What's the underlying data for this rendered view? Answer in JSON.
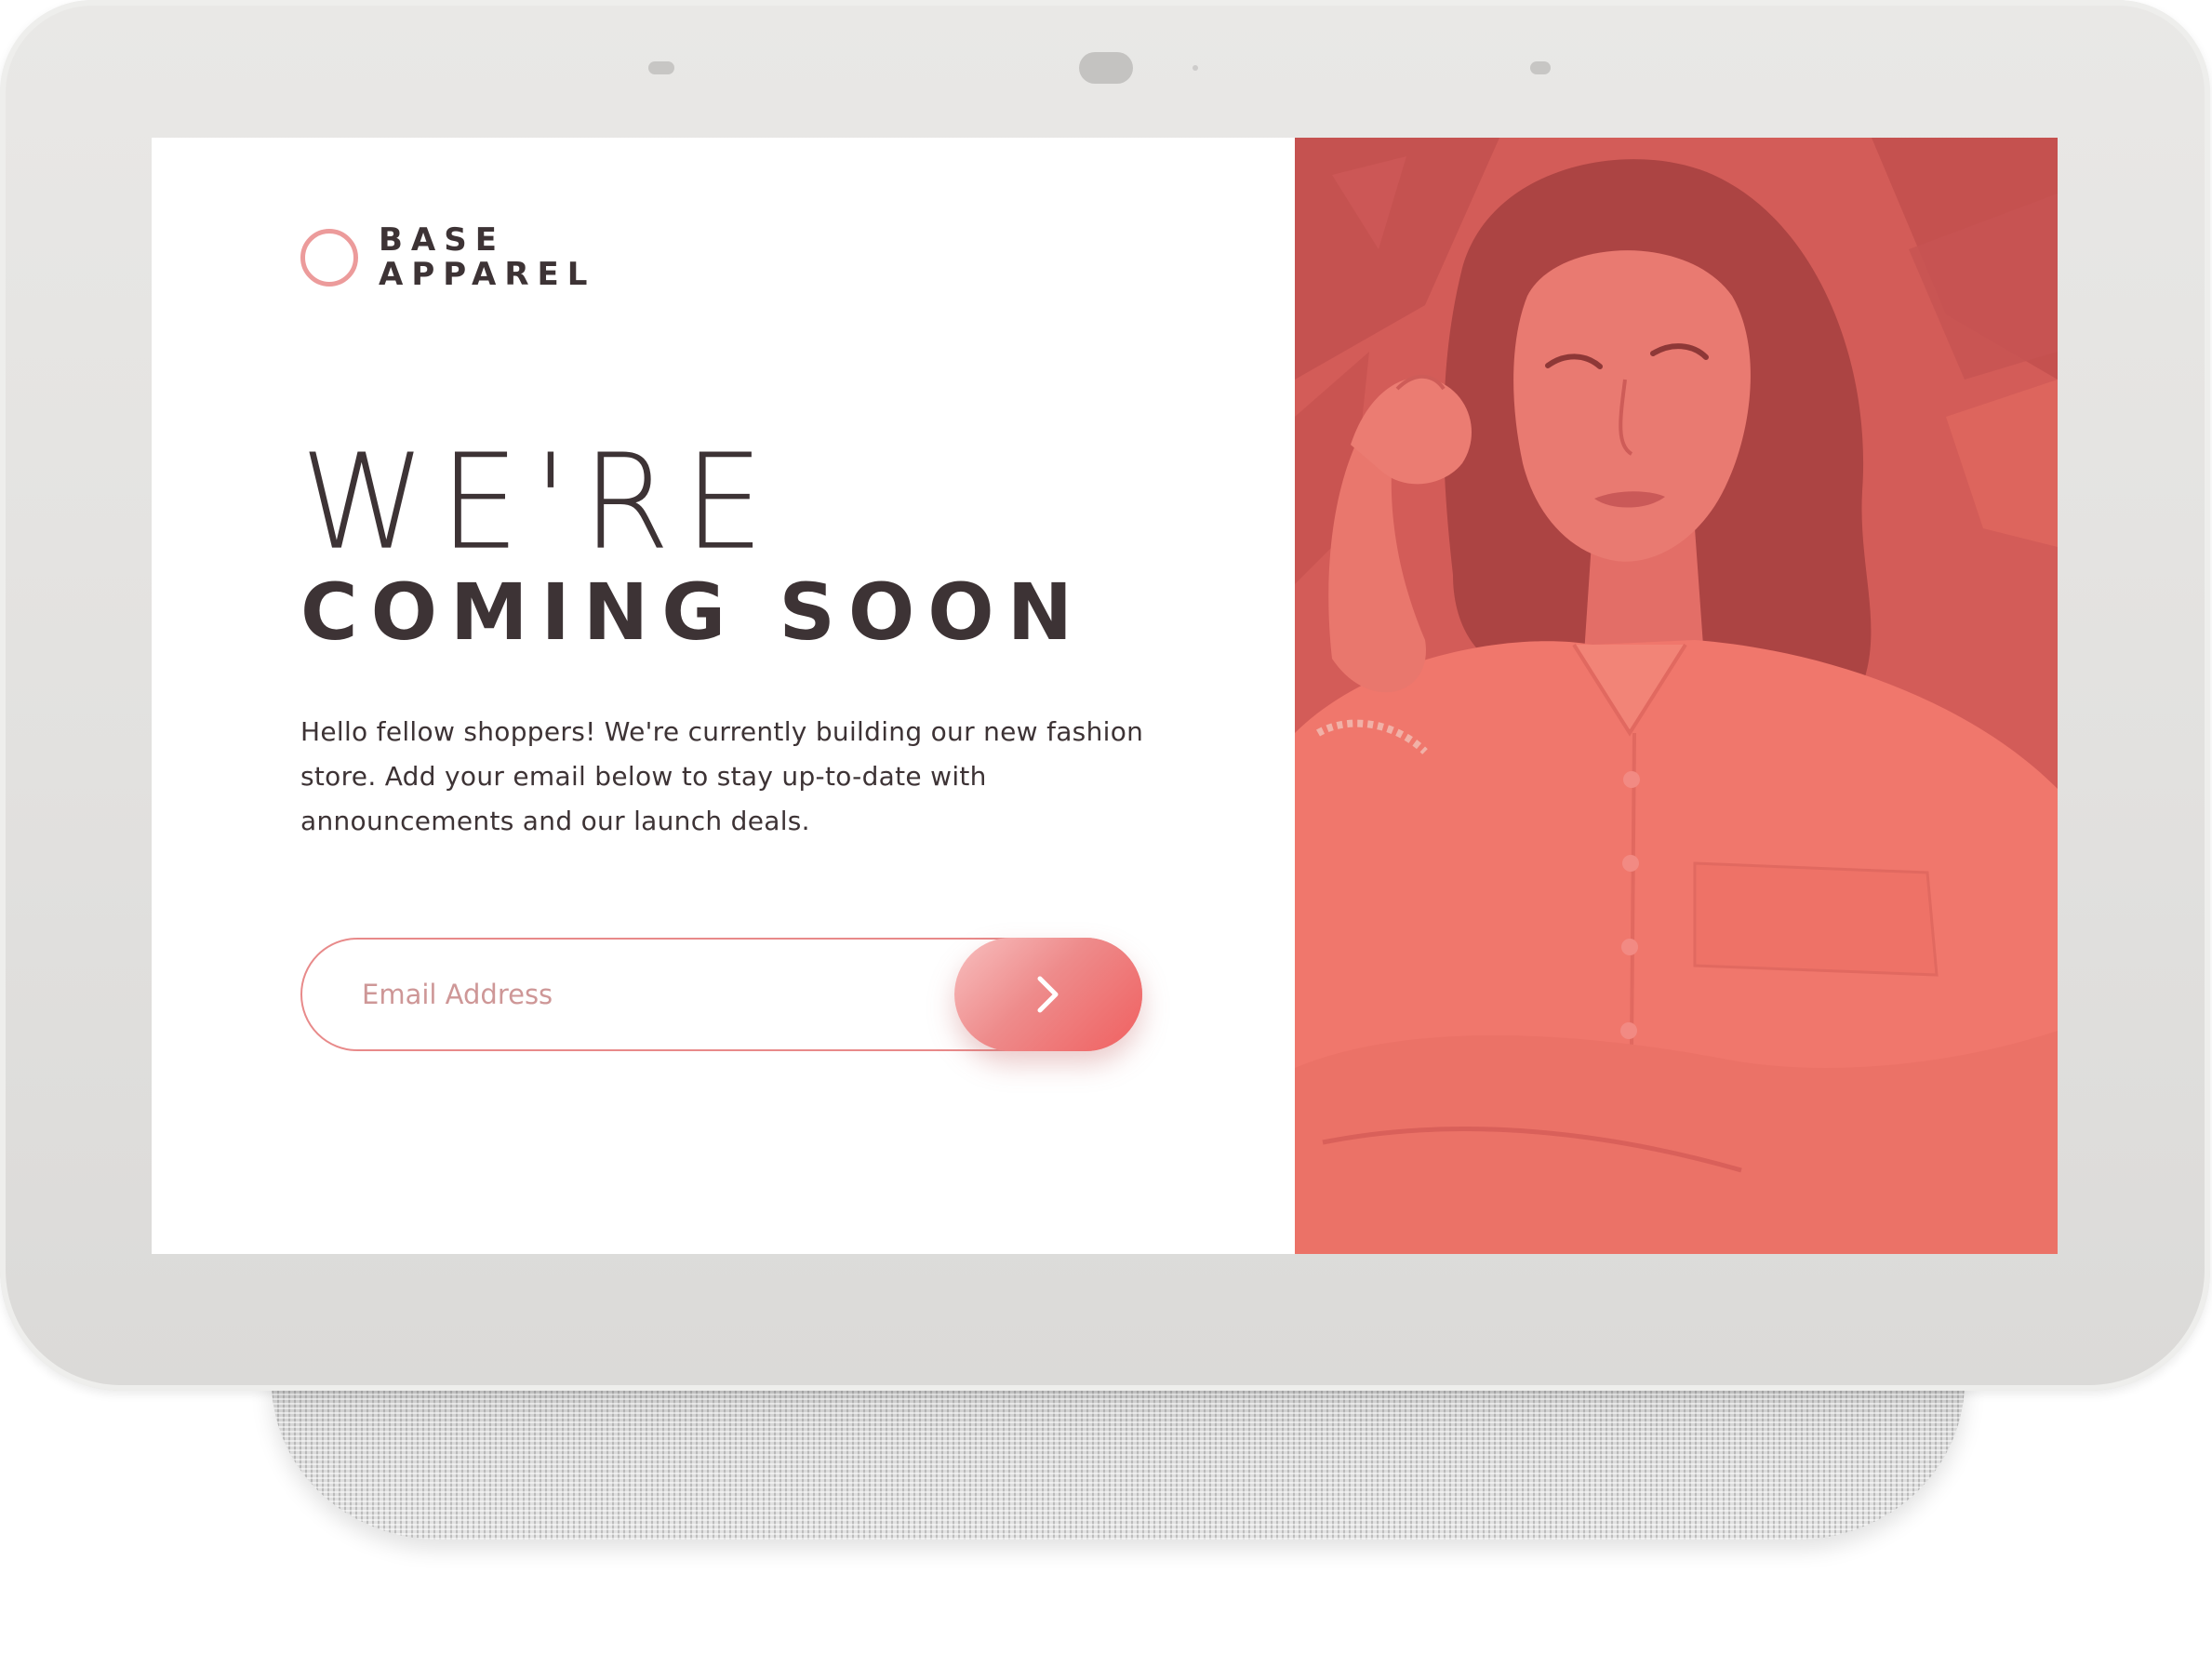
{
  "brand": {
    "line1": "BASE",
    "line2": "APPAREL"
  },
  "headline": {
    "light": "WE'RE",
    "bold": "COMING SOON"
  },
  "description": "Hello fellow shoppers! We're currently building our new fashion store. Add your email below to stay up-to-date with announcements and our launch deals.",
  "email_form": {
    "placeholder": "Email Address",
    "submit_icon": "chevron-right-icon"
  },
  "hero": {
    "subject": "woman-portrait"
  },
  "colors": {
    "accent": "#f06060",
    "accent_soft": "#ec9b9b",
    "text": "#3d3335",
    "placeholder": "#ce9797",
    "overlay": "#e86b62"
  }
}
